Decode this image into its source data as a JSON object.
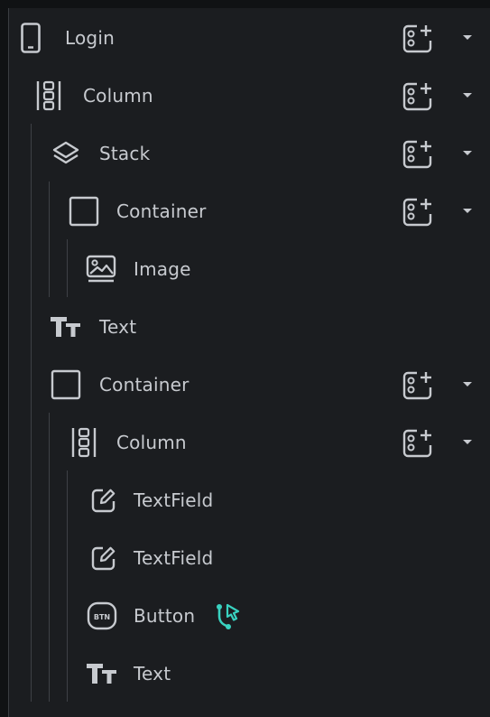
{
  "accent": "#39d2c0",
  "tree": [
    {
      "label": "Login",
      "icon": "phone-icon",
      "has_add": true
    },
    {
      "label": "Column",
      "icon": "column-icon",
      "has_add": true
    },
    {
      "label": "Stack",
      "icon": "stack-icon",
      "has_add": true
    },
    {
      "label": "Container",
      "icon": "container-icon",
      "has_add": true
    },
    {
      "label": "Image",
      "icon": "image-icon",
      "has_add": false
    },
    {
      "label": "Text",
      "icon": "text-icon",
      "has_add": false
    },
    {
      "label": "Container",
      "icon": "container-icon",
      "has_add": true
    },
    {
      "label": "Column",
      "icon": "column-icon",
      "has_add": true
    },
    {
      "label": "TextField",
      "icon": "textfield-icon",
      "has_add": false
    },
    {
      "label": "TextField",
      "icon": "textfield-icon",
      "has_add": false
    },
    {
      "label": "Button",
      "icon": "button-icon",
      "has_add": false,
      "badge_icon": "action-flow-icon",
      "badge_text": "BTN"
    },
    {
      "label": "Text",
      "icon": "text-icon",
      "has_add": false
    }
  ]
}
